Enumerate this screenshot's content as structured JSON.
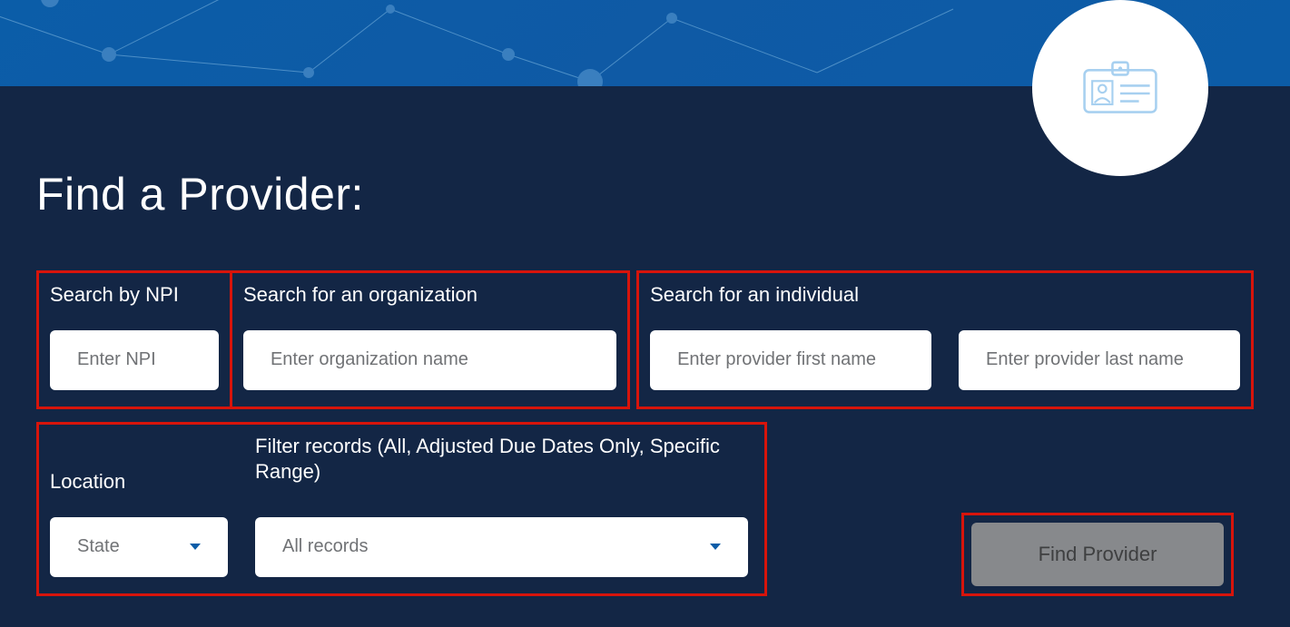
{
  "header": {
    "title": "Find a Provider:"
  },
  "search": {
    "npi": {
      "label": "Search by NPI",
      "placeholder": "Enter NPI"
    },
    "organization": {
      "label": "Search for an organization",
      "placeholder": "Enter organization name"
    },
    "individual": {
      "label": "Search for an individual",
      "first_placeholder": "Enter provider first name",
      "last_placeholder": "Enter provider last name"
    },
    "location": {
      "label": "Location",
      "selected": "State"
    },
    "filter": {
      "label": "Filter records (All, Adjusted Due Dates Only, Specific Range)",
      "selected": "All records"
    }
  },
  "actions": {
    "find_label": "Find Provider"
  },
  "icons": {
    "badge": "id-card-icon"
  },
  "colors": {
    "banner": "#0b5da8",
    "panel": "#132645",
    "highlight_border": "#d7140b",
    "button_bg": "#87898c"
  }
}
